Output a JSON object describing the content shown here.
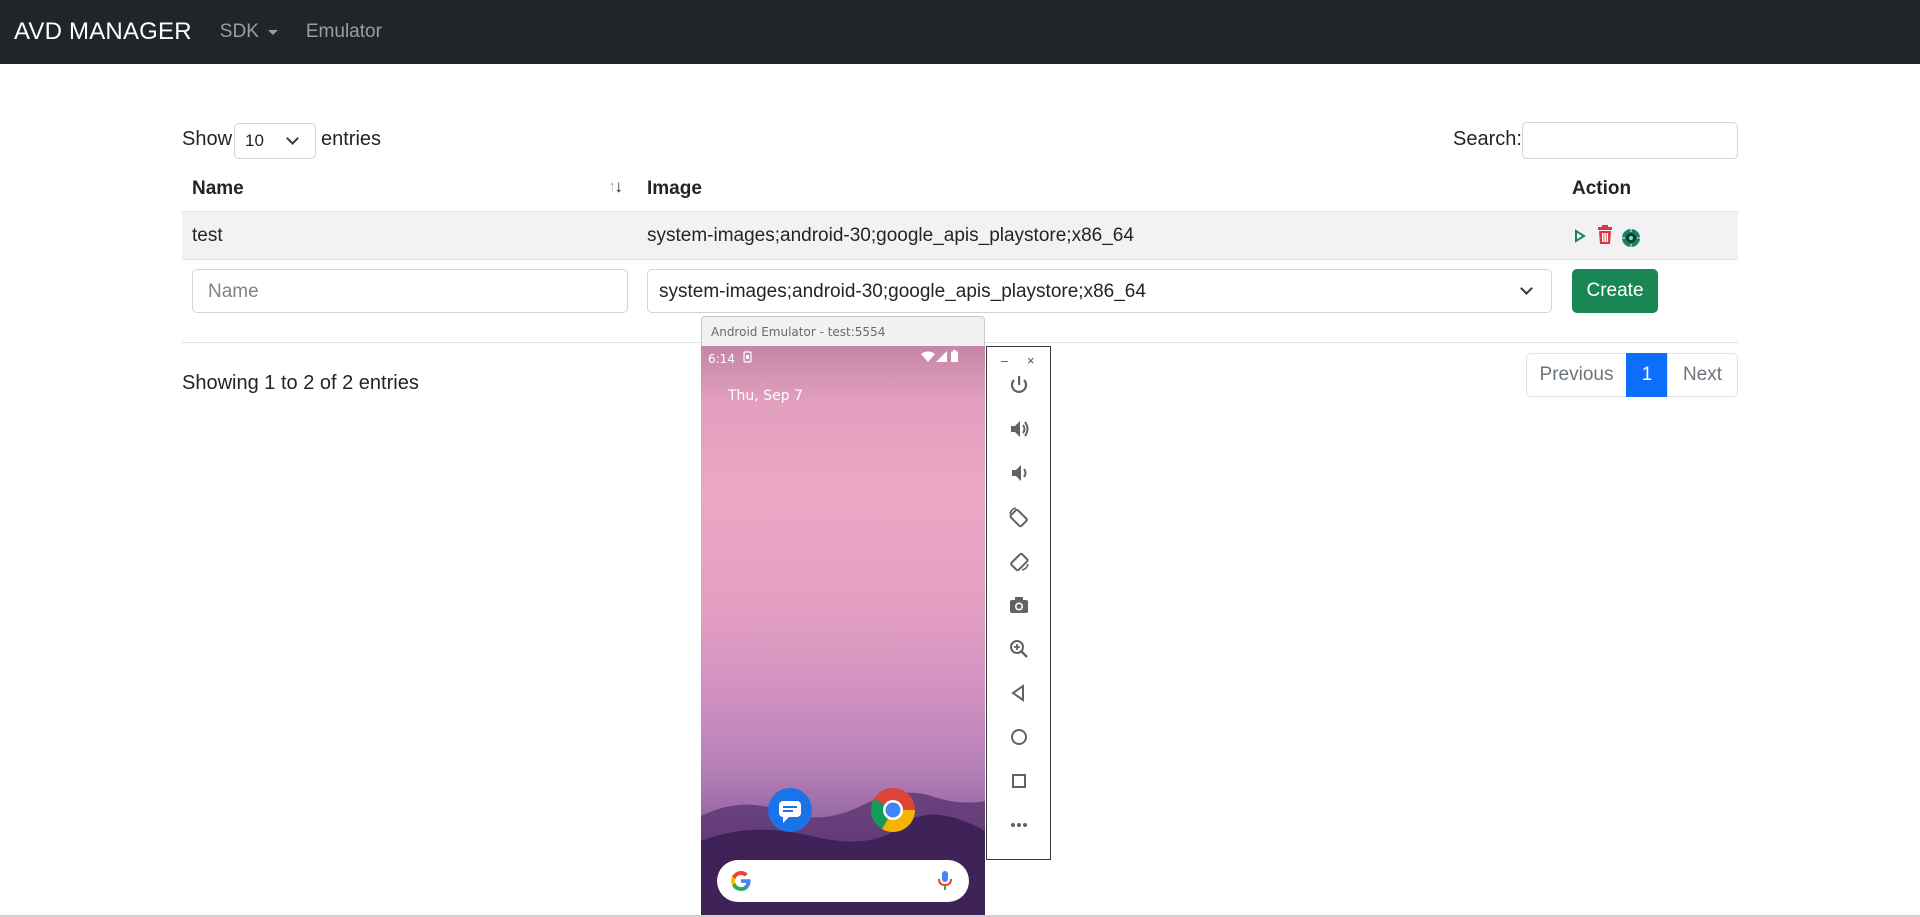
{
  "navbar": {
    "brand": "AVD MANAGER",
    "links": [
      {
        "label": "SDK",
        "dropdown": true
      },
      {
        "label": "Emulator",
        "dropdown": false
      }
    ]
  },
  "table_controls": {
    "show_label": "Show",
    "page_length": "10",
    "entries_label": "entries",
    "search_label": "Search:",
    "search_value": ""
  },
  "table": {
    "columns": [
      "Name",
      "Image",
      "Action"
    ],
    "rows": [
      {
        "name": "test",
        "image": "system-images;android-30;google_apis_playstore;x86_64",
        "actions": [
          "play-icon",
          "trash-icon",
          "emulator-icon"
        ]
      }
    ],
    "new_row": {
      "name_placeholder": "Name",
      "image_selected": "system-images;android-30;google_apis_playstore;x86_64",
      "create_label": "Create"
    }
  },
  "info": "Showing 1 to 2 of 2 entries",
  "pagination": {
    "previous": "Previous",
    "current": "1",
    "next": "Next"
  },
  "emulator": {
    "title": "Android Emulator - test:5554",
    "status_time": "6:14",
    "date": "Thu, Sep 7",
    "controls": [
      "power-icon",
      "volume-up-icon",
      "volume-down-icon",
      "rotate-left-icon",
      "rotate-right-icon",
      "camera-icon",
      "zoom-icon",
      "back-icon",
      "home-icon",
      "overview-icon",
      "more-icon"
    ],
    "window_controls": [
      "–",
      "×"
    ]
  },
  "colors": {
    "navbar_bg": "#212529",
    "create_button": "#198754",
    "pagination_active": "#0d6efd",
    "play_icon": "#198754",
    "trash_icon": "#dc3545"
  }
}
